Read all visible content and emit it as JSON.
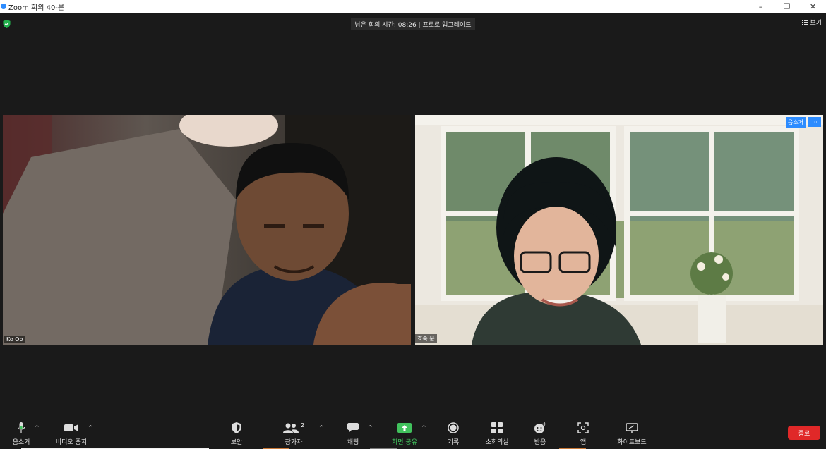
{
  "window": {
    "title": "Zoom 회의 40-분",
    "controls": [
      "–",
      "❐",
      "✕"
    ]
  },
  "meeting": {
    "timer_text": "남은 회의 시간: 08:26 | 프로로 업그레이드",
    "view_label": "보기"
  },
  "participants": [
    {
      "name": "Ko Oo"
    },
    {
      "name": "효숙 윤",
      "mute_label": "음소거",
      "more_label": "···"
    }
  ],
  "toolbar": {
    "mute": "음소거",
    "video": "비디오 중지",
    "security": "보안",
    "participants": "참가자",
    "participants_count": "2",
    "chat": "채팅",
    "share": "화면 공유",
    "record": "기록",
    "breakout": "소회의실",
    "reactions": "반응",
    "apps": "앱",
    "whiteboard": "화이트보드",
    "end": "종료",
    "caret": "^"
  },
  "colors": {
    "accent": "#2d8cff",
    "share_green": "#41c25d",
    "end_red": "#e02828"
  }
}
